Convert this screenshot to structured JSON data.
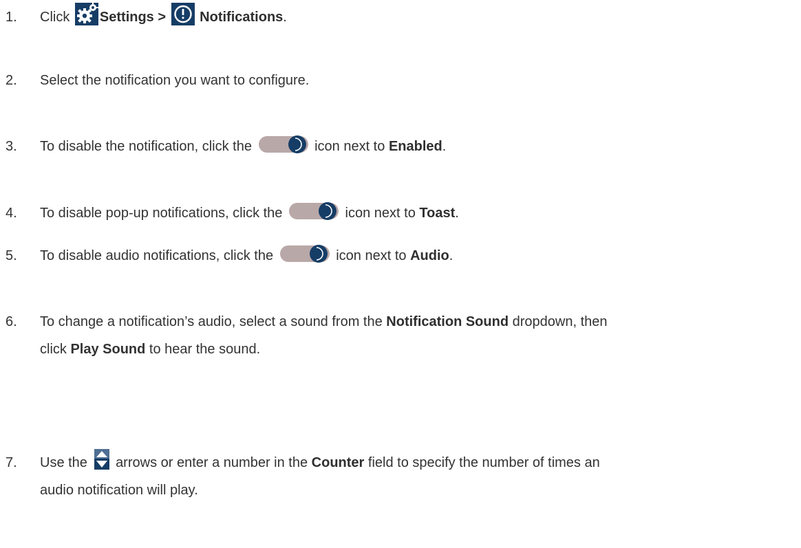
{
  "steps": [
    {
      "num": "1.",
      "t1": "Click",
      "b1": "Settings >",
      "b2": "Notifications",
      "t2": "."
    },
    {
      "num": "2.",
      "t1": "Select the notification you want to configure."
    },
    {
      "num": "3.",
      "t1": "To disable the notification, click the",
      "t2": "icon next to",
      "b1": "Enabled",
      "t3": "."
    },
    {
      "num": "4.",
      "t1": "To disable pop-up notifications, click the",
      "t2": "icon next to",
      "b1": "Toast",
      "t3": "."
    },
    {
      "num": "5.",
      "t1": "To disable audio notifications, click the",
      "t2": "icon next to",
      "b1": "Audio",
      "t3": "."
    },
    {
      "num": "6.",
      "t1": "To change a notification’s audio, select a sound from the",
      "b1": "Notification Sound",
      "t2": "dropdown, then",
      "t3": "click",
      "b2": "Play Sound",
      "t4": "to hear the sound."
    },
    {
      "num": "7.",
      "t1": "Use the",
      "t2": "arrows or enter a number in the",
      "b1": "Counter",
      "t3": "field to specify the number of times an",
      "t4": "audio notification will play."
    }
  ],
  "icons": {
    "settings": "gear-icon",
    "notifications": "exclamation-circle-icon",
    "toggle": "toggle-switch-icon",
    "arrows": "up-down-arrows-icon"
  },
  "colors": {
    "icon_bg": "#163d66",
    "toggle_track": "#b9a8a8",
    "toggle_knob": "#163d66",
    "text": "#333333"
  }
}
